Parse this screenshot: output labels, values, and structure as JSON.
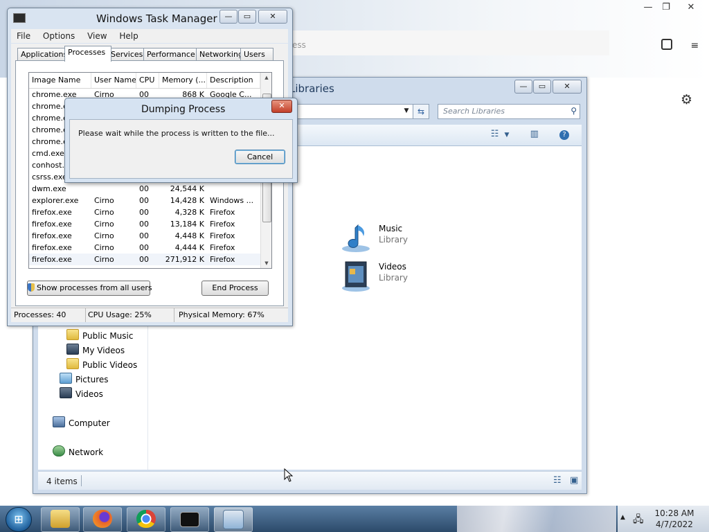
{
  "browser": {
    "ghost_text": "ess",
    "window_controls": {
      "minimize": "—",
      "restore": "❐",
      "close": "✕"
    }
  },
  "explorer": {
    "title": "Libraries",
    "search_placeholder": "Search Libraries",
    "nav": {
      "items": [
        {
          "label": "Public Music",
          "icon": "folder-icon"
        },
        {
          "label": "My Videos",
          "icon": "videos-icon"
        },
        {
          "label": "Public Videos",
          "icon": "folder-icon"
        },
        {
          "label": "Pictures",
          "icon": "pictures-icon"
        },
        {
          "label": "Videos",
          "icon": "videos-icon"
        },
        {
          "label": "Computer",
          "icon": "computer-icon"
        },
        {
          "label": "Network",
          "icon": "network-icon"
        }
      ]
    },
    "libraries": [
      {
        "name": "Music",
        "sub": "Library",
        "icon": "music-icon"
      },
      {
        "name": "Videos",
        "sub": "Library",
        "icon": "video-library-icon"
      }
    ],
    "status_count": "4 items"
  },
  "taskmgr": {
    "title": "Windows Task Manager",
    "menu": [
      "File",
      "Options",
      "View",
      "Help"
    ],
    "tabs": [
      "Applications",
      "Processes",
      "Services",
      "Performance",
      "Networking",
      "Users"
    ],
    "active_tab": 1,
    "columns": [
      "Image Name",
      "User Name",
      "CPU",
      "Memory (...",
      "Description"
    ],
    "rows": [
      [
        "chrome.exe",
        "Cirno",
        "00",
        "868 K",
        "Google C..."
      ],
      [
        "chrome.exe",
        "",
        "",
        "",
        ""
      ],
      [
        "chrome.exe",
        "",
        "",
        "",
        ""
      ],
      [
        "chrome.exe",
        "",
        "",
        "",
        ""
      ],
      [
        "chrome.exe",
        "",
        "",
        "",
        ""
      ],
      [
        "cmd.exe",
        "",
        "",
        "",
        ""
      ],
      [
        "conhost.exe",
        "",
        "",
        "",
        ""
      ],
      [
        "csrss.exe",
        "",
        "",
        "",
        ""
      ],
      [
        "dwm.exe",
        "",
        "00",
        "24,544 K",
        ""
      ],
      [
        "explorer.exe",
        "Cirno",
        "00",
        "14,428 K",
        "Windows ..."
      ],
      [
        "firefox.exe",
        "Cirno",
        "00",
        "4,328 K",
        "Firefox"
      ],
      [
        "firefox.exe",
        "Cirno",
        "00",
        "13,184 K",
        "Firefox"
      ],
      [
        "firefox.exe",
        "Cirno",
        "00",
        "4,448 K",
        "Firefox"
      ],
      [
        "firefox.exe",
        "Cirno",
        "00",
        "4,444 K",
        "Firefox"
      ],
      [
        "firefox.exe",
        "Cirno",
        "00",
        "271,912 K",
        "Firefox"
      ]
    ],
    "show_all_label": "Show processes from all users",
    "end_process_label": "End Process",
    "status": {
      "processes": "Processes: 40",
      "cpu": "CPU Usage: 25%",
      "memory": "Physical Memory: 67%"
    }
  },
  "dump_dialog": {
    "title": "Dumping Process",
    "message": "Please wait while the process is written to the file...",
    "cancel_label": "Cancel",
    "close_glyph": "✕"
  },
  "taskbar": {
    "start_glyph": "⊞",
    "apps": [
      {
        "name": "explorer",
        "color": "#e8c25a"
      },
      {
        "name": "firefox",
        "color": "#e8652a"
      },
      {
        "name": "chrome",
        "color": "#3aa457"
      },
      {
        "name": "cmd",
        "color": "#111111"
      },
      {
        "name": "taskmgr",
        "color": "#8fb3d6"
      }
    ],
    "clock_time": "10:28 AM",
    "clock_date": "4/7/2022"
  },
  "colors": {
    "accent": "#3c7fb1",
    "close_red": "#c3402a"
  }
}
